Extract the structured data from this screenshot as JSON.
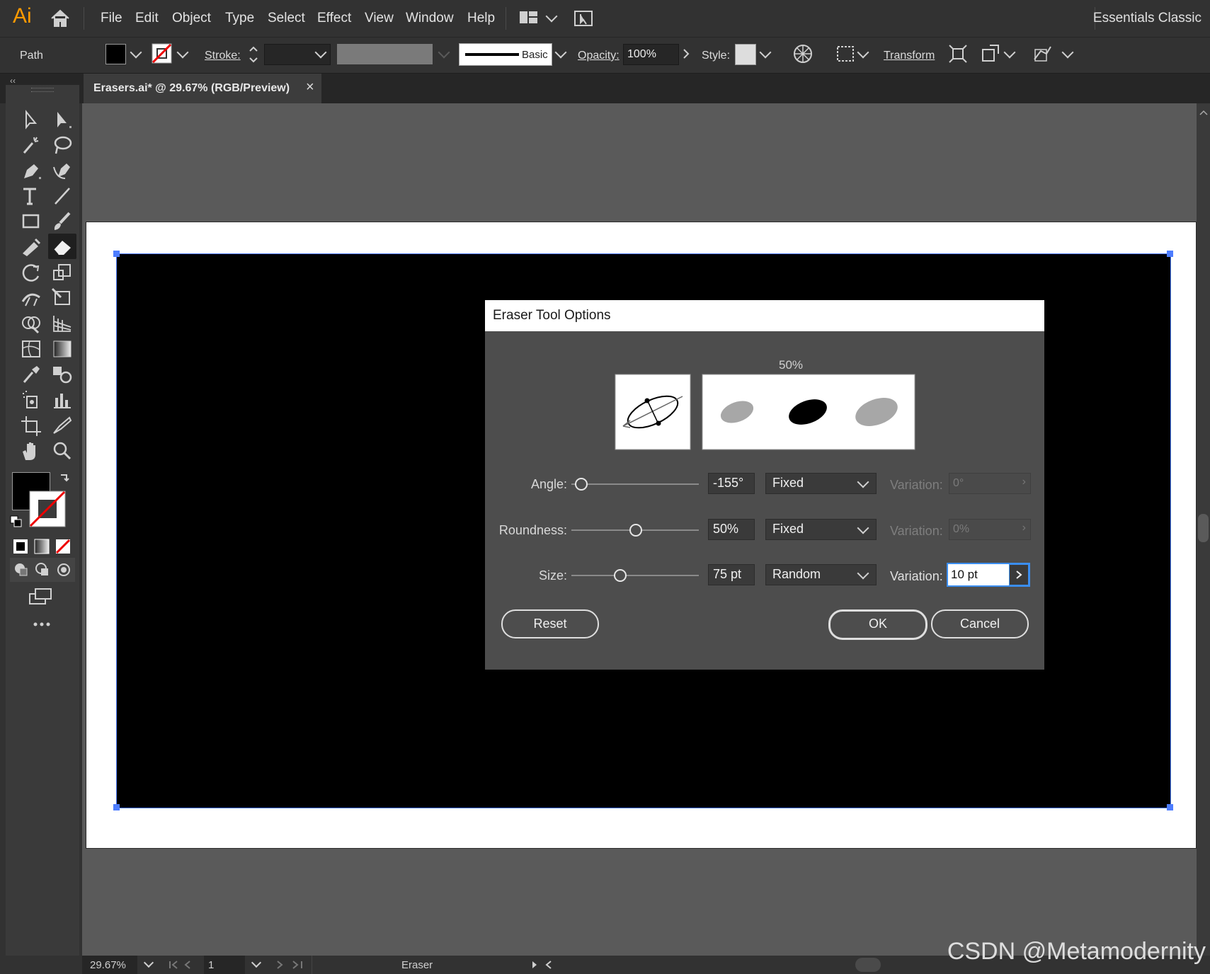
{
  "app": {
    "logo": "Ai",
    "workspace": "Essentials Classic"
  },
  "menu": [
    "File",
    "Edit",
    "Object",
    "Type",
    "Select",
    "Effect",
    "View",
    "Window",
    "Help"
  ],
  "control_bar": {
    "selection_type": "Path",
    "stroke_label": "Stroke:",
    "brush_name": "Basic",
    "opacity_label": "Opacity:",
    "opacity_value": "100%",
    "style_label": "Style:",
    "transform_label": "Transform"
  },
  "document_tab": {
    "title": "Erasers.ai* @ 29.67% (RGB/Preview)",
    "close": "×"
  },
  "dialog": {
    "title": "Eraser Tool Options",
    "preview_label": "50%",
    "angle": {
      "label": "Angle:",
      "value": "-155°",
      "mode": "Fixed",
      "variation_label": "Variation:",
      "variation_value": "0°",
      "slider_fraction": 0.07
    },
    "roundness": {
      "label": "Roundness:",
      "value": "50%",
      "mode": "Fixed",
      "variation_label": "Variation:",
      "variation_value": "0%",
      "slider_fraction": 0.5
    },
    "size": {
      "label": "Size:",
      "value": "75 pt",
      "mode": "Random",
      "variation_label": "Variation:",
      "variation_value": "10 pt",
      "slider_fraction": 0.38
    },
    "reset_label": "Reset",
    "ok_label": "OK",
    "cancel_label": "Cancel"
  },
  "status_bar": {
    "zoom": "29.67%",
    "artboard_number": "1",
    "current_tool": "Eraser"
  },
  "watermark": "CSDN @Metamodernity",
  "colors": {
    "ui_dark": "#323232",
    "canvas": "#5a5a5a",
    "dialog": "#4d4d4d",
    "selection": "#4d7dff",
    "logo": "#ff9a00"
  }
}
